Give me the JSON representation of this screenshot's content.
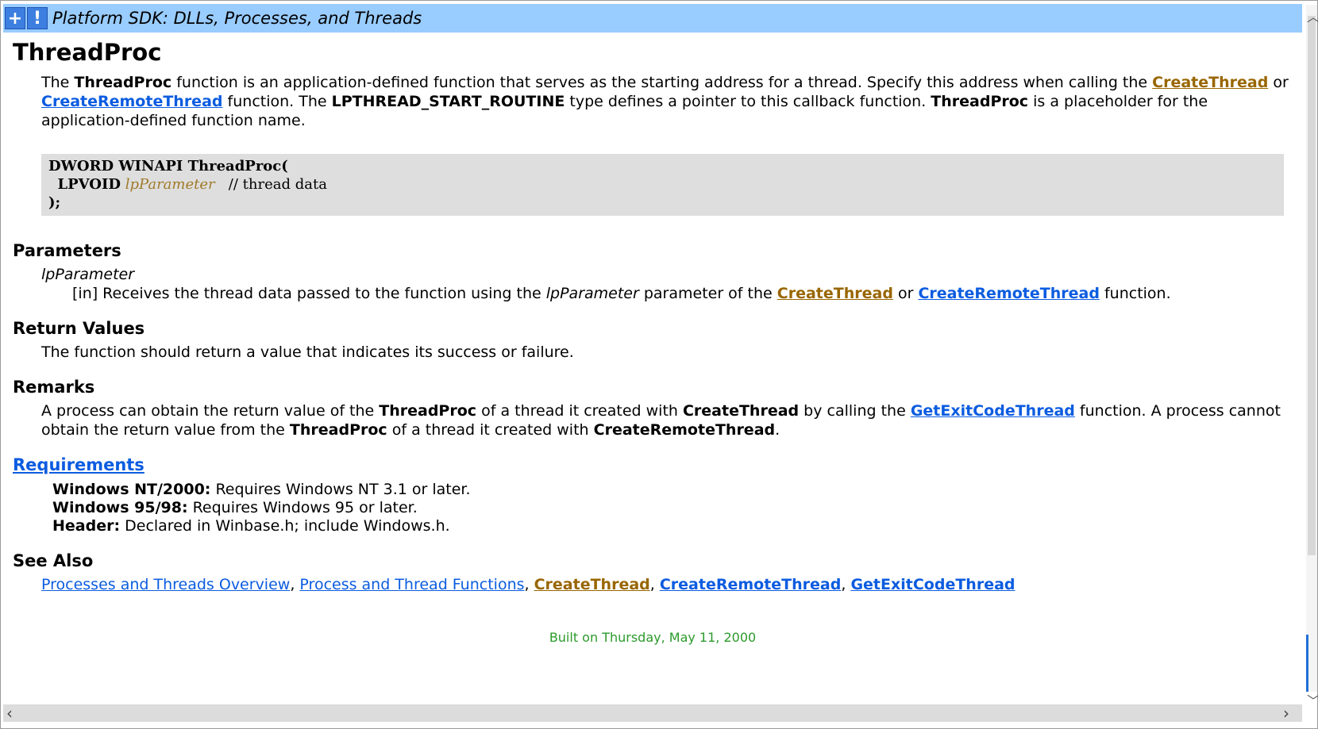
{
  "header": {
    "title": "Platform SDK: DLLs, Processes, and Threads",
    "plus_icon": "+",
    "info_icon": "!"
  },
  "page": {
    "heading": "ThreadProc",
    "intro": {
      "t1": "The ",
      "b1": "ThreadProc",
      "t2": " function is an application-defined function that serves as the starting address for a thread. Specify this address when calling the ",
      "l1": "CreateThread",
      "t3": " or ",
      "l2": "CreateRemoteThread",
      "t4": " function. The ",
      "b2": "LPTHREAD_START_ROUTINE",
      "t5": " type defines a pointer to this callback function. ",
      "b3": "ThreadProc",
      "t6": " is a placeholder for the application-defined function name."
    },
    "code": {
      "line1": "DWORD WINAPI ThreadProc(",
      "line2_type": "LPVOID",
      "line2_param": "lpParameter",
      "line2_comment": "// thread data",
      "line3": ");"
    },
    "parameters": {
      "heading": "Parameters",
      "term": "lpParameter",
      "d1": "[in] Receives the thread data passed to the function using the ",
      "d_param": "lpParameter",
      "d2": " parameter of the ",
      "l1": "CreateThread",
      "d3": " or ",
      "l2": "CreateRemoteThread",
      "d4": " function."
    },
    "return_values": {
      "heading": "Return Values",
      "text": "The function should return a value that indicates its success or failure."
    },
    "remarks": {
      "heading": "Remarks",
      "t1": "A process can obtain the return value of the ",
      "b1": "ThreadProc",
      "t2": " of a thread it created with ",
      "b2": "CreateThread",
      "t3": " by calling the ",
      "l1": "GetExitCodeThread",
      "t4": " function. A process cannot obtain the return value from the ",
      "b3": "ThreadProc",
      "t5": " of a thread it created with ",
      "b4": "CreateRemoteThread",
      "t6": "."
    },
    "requirements": {
      "heading": "Requirements",
      "nt_label": "Windows NT/2000:",
      "nt_text": " Requires Windows NT 3.1 or later.",
      "w9x_label": "Windows 95/98:",
      "w9x_text": " Requires Windows 95 or later.",
      "header_label": "Header:",
      "header_text": " Declared in Winbase.h; include Windows.h."
    },
    "see_also": {
      "heading": "See Also",
      "links": [
        "Processes and Threads Overview",
        "Process and Thread Functions",
        "CreateThread",
        "CreateRemoteThread",
        "GetExitCodeThread"
      ],
      "sep": ", "
    },
    "footer": "Built on Thursday, May 11, 2000"
  },
  "colors": {
    "titlebar": "#99ccff",
    "link": "#0b5ce0",
    "visited_link": "#996600",
    "footer": "#2c9a2c",
    "code_bg": "#dedede"
  }
}
